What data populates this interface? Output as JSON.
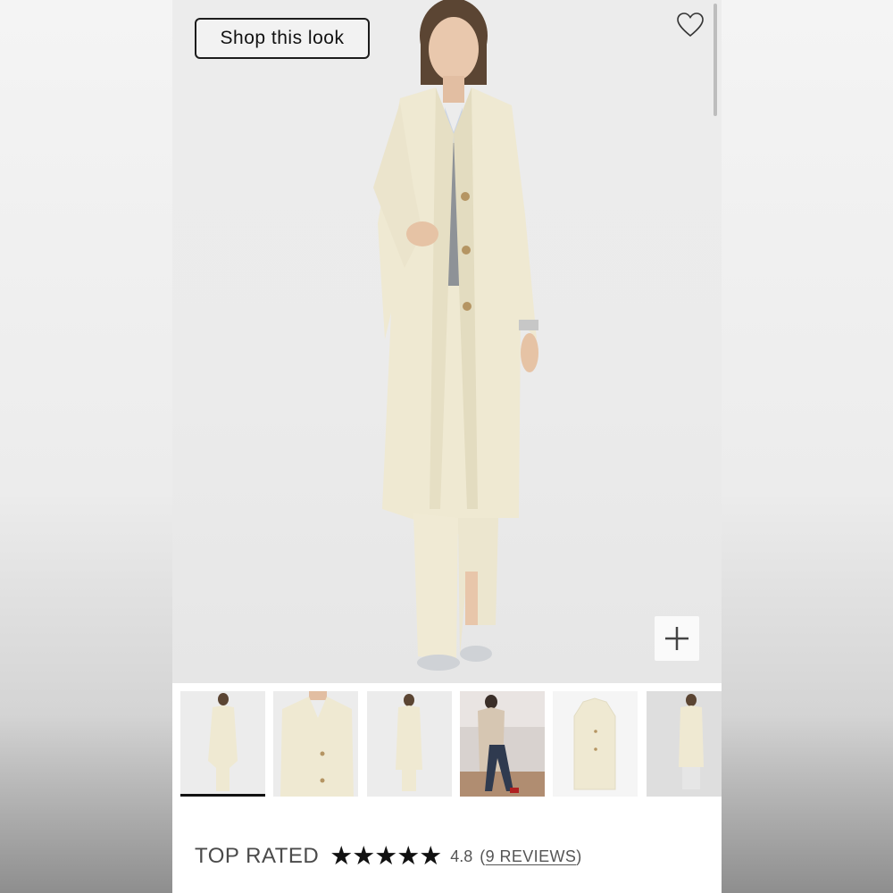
{
  "hero": {
    "shop_button_label": "Shop this look"
  },
  "icons": {
    "favorite": "heart-outline-icon",
    "zoom": "plus-icon"
  },
  "thumbnails": [
    {
      "name": "thumbnail-1",
      "active": true
    },
    {
      "name": "thumbnail-2",
      "active": false
    },
    {
      "name": "thumbnail-3",
      "active": false
    },
    {
      "name": "thumbnail-4",
      "active": false
    },
    {
      "name": "thumbnail-5",
      "active": false
    },
    {
      "name": "thumbnail-6",
      "active": false
    }
  ],
  "rating": {
    "label": "TOP RATED",
    "stars": 5,
    "score": "4.8",
    "reviews_open": "(",
    "reviews_link": "9 REVIEWS",
    "reviews_close": ")"
  },
  "colors": {
    "coat": "#efe9d2",
    "accent": "#111111"
  }
}
